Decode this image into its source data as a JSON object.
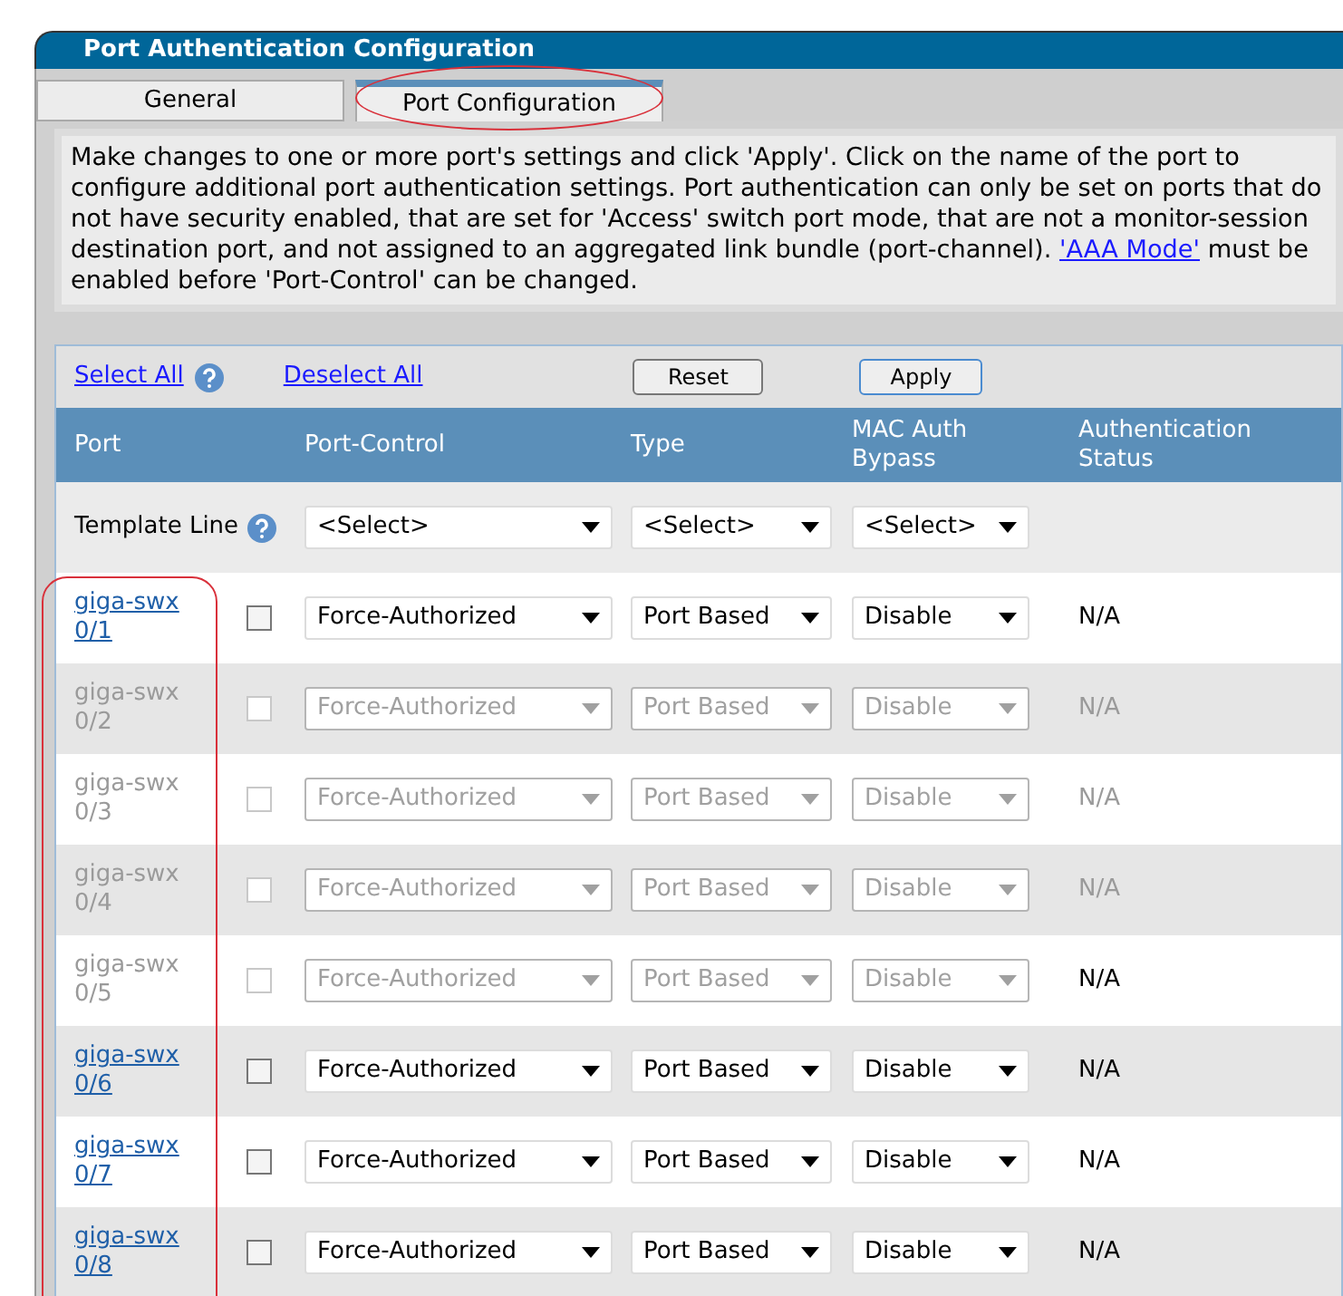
{
  "window": {
    "title": "Port Authentication Configuration"
  },
  "tabs": [
    {
      "label": "General",
      "selected": false,
      "circled": false
    },
    {
      "label": "Port Configuration",
      "selected": true,
      "circled": true
    }
  ],
  "description": {
    "text": "Make changes to one or more port's settings and click 'Apply'. Click on the name of the port to configure additional port authentication settings. Port authentication can only be set on ports that do not have security enabled, that are set for 'Access' switch port mode, that are not a monitor-session destination port, and not assigned to an aggregated link bundle (port-channel).",
    "link": "'AAA Mode'",
    "text_after": "must be enabled before 'Port-Control' can be changed."
  },
  "toolbar": {
    "select_all": "Select All",
    "deselect_all": "Deselect All",
    "reset": "Reset",
    "apply": "Apply"
  },
  "table": {
    "columns": [
      "Port",
      "Port-Control",
      "Type",
      "MAC Auth Bypass",
      "Authentication Status"
    ],
    "port_column_circled": true,
    "template": {
      "label": "Template Line",
      "port_control": "<Select>",
      "type": "<Select>",
      "mac_auth_bypass": "<Select>"
    },
    "rows": [
      {
        "port": "giga-swx 0/1",
        "disabled": false,
        "checked": false,
        "port_control": "Force-Authorized",
        "type": "Port Based",
        "mac_auth_bypass": "Disable",
        "status": "N/A",
        "status_disabled": false
      },
      {
        "port": "giga-swx 0/2",
        "disabled": true,
        "checked": false,
        "port_control": "Force-Authorized",
        "type": "Port Based",
        "mac_auth_bypass": "Disable",
        "status": "N/A",
        "status_disabled": true
      },
      {
        "port": "giga-swx 0/3",
        "disabled": true,
        "checked": false,
        "port_control": "Force-Authorized",
        "type": "Port Based",
        "mac_auth_bypass": "Disable",
        "status": "N/A",
        "status_disabled": true
      },
      {
        "port": "giga-swx 0/4",
        "disabled": true,
        "checked": false,
        "port_control": "Force-Authorized",
        "type": "Port Based",
        "mac_auth_bypass": "Disable",
        "status": "N/A",
        "status_disabled": true
      },
      {
        "port": "giga-swx 0/5",
        "disabled": true,
        "checked": false,
        "port_control": "Force-Authorized",
        "type": "Port Based",
        "mac_auth_bypass": "Disable",
        "status": "N/A",
        "status_disabled": false
      },
      {
        "port": "giga-swx 0/6",
        "disabled": false,
        "checked": false,
        "port_control": "Force-Authorized",
        "type": "Port Based",
        "mac_auth_bypass": "Disable",
        "status": "N/A",
        "status_disabled": false
      },
      {
        "port": "giga-swx 0/7",
        "disabled": false,
        "checked": false,
        "port_control": "Force-Authorized",
        "type": "Port Based",
        "mac_auth_bypass": "Disable",
        "status": "N/A",
        "status_disabled": false
      },
      {
        "port": "giga-swx 0/8",
        "disabled": false,
        "checked": false,
        "port_control": "Force-Authorized",
        "type": "Port Based",
        "mac_auth_bypass": "Disable",
        "status": "N/A",
        "status_disabled": false
      }
    ]
  }
}
